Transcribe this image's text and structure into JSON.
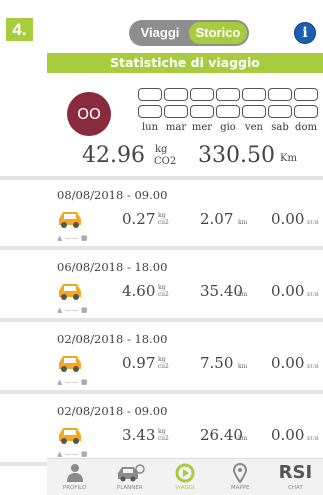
{
  "step": "4.",
  "toggle": {
    "options": [
      "Viaggi",
      "Storico"
    ],
    "active": "Storico"
  },
  "info_icon": "i",
  "stats_title": "Statistiche di viaggio",
  "avatar": {
    "initials": "OO",
    "color": "#8a2a3d"
  },
  "week": {
    "days": [
      "lun",
      "mar",
      "mer",
      "gio",
      "ven",
      "sab",
      "dom"
    ]
  },
  "totals": {
    "co2_value": "42.96",
    "co2_unit_top": "kg",
    "co2_unit_bottom": "CO2",
    "km_value": "330.50",
    "km_unit": "Km"
  },
  "trips": [
    {
      "date": "08/08/2018 - 09.00",
      "co2": "0.27",
      "km": "2.07",
      "eur": "0.00",
      "route": "home-to-work"
    },
    {
      "date": "06/08/2018 - 18.00",
      "co2": "4.60",
      "km": "35.40",
      "eur": "0.00",
      "route": "work-to-home"
    },
    {
      "date": "02/08/2018 - 18.00",
      "co2": "0.97",
      "km": "7.50",
      "eur": "0.00",
      "route": "work-to-home"
    },
    {
      "date": "02/08/2018 - 09.00",
      "co2": "3.43",
      "km": "26.40",
      "eur": "0.00",
      "route": "home-to-work"
    }
  ],
  "units": {
    "kg": "kg",
    "co2": "co2",
    "km": "km",
    "eur": "EUR"
  },
  "nav": [
    {
      "label": "PROFILO",
      "icon": "person-icon"
    },
    {
      "label": "PLANNER",
      "icon": "car-planner-icon"
    },
    {
      "label": "VIAGGI",
      "icon": "play-icon",
      "active": true
    },
    {
      "label": "MAPPE",
      "icon": "map-pin-icon"
    },
    {
      "label": "CHAT",
      "icon": "rsi-logo",
      "logo_text": "RSI"
    }
  ],
  "colors": {
    "accent": "#a7cd3e",
    "car": "#f5a623",
    "info": "#1c5fb0"
  }
}
